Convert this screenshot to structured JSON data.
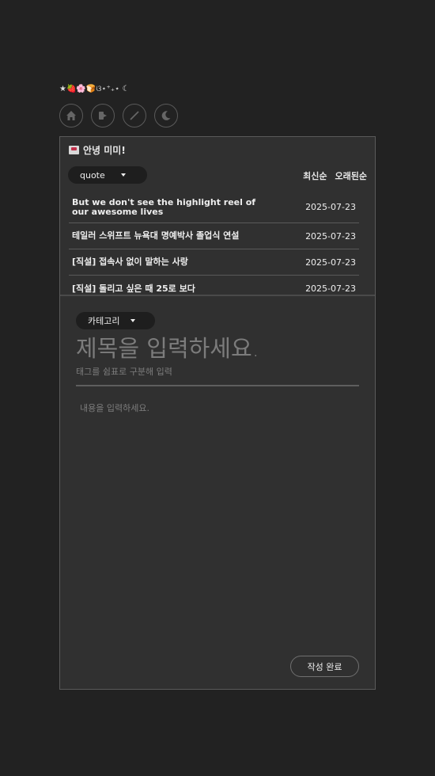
{
  "header": {
    "decoration": "★🍓🌸🍞ଓ⋆⁺₊⋆ ☾"
  },
  "nav": [
    {
      "name": "home-icon"
    },
    {
      "name": "logout-icon"
    },
    {
      "name": "write-icon"
    },
    {
      "name": "moon-icon"
    }
  ],
  "greeting": "안녕 미미!",
  "filter": {
    "selected": "quote"
  },
  "sort": {
    "newest": "최신순",
    "oldest": "오래된순"
  },
  "posts": [
    {
      "title": "But we don't see the highlight reel of our awesome lives",
      "date": "2025-07-23"
    },
    {
      "title": "테일러 스위프트 뉴욕대 명예박사 졸업식 연설",
      "date": "2025-07-23"
    },
    {
      "title": "[직설] 접속사 없이 말하는 사랑",
      "date": "2025-07-23"
    },
    {
      "title": "[직설] 돌리고 싶은 때 25로 보다",
      "date": "2025-07-23"
    }
  ],
  "editor": {
    "category_label": "카테고리",
    "title_placeholder": "제목을 입력하세요.",
    "tags_placeholder": "태그를 쉼표로 구분해 입력",
    "content_placeholder": "내용을 입력하세요.",
    "submit_label": "작성 완료"
  }
}
